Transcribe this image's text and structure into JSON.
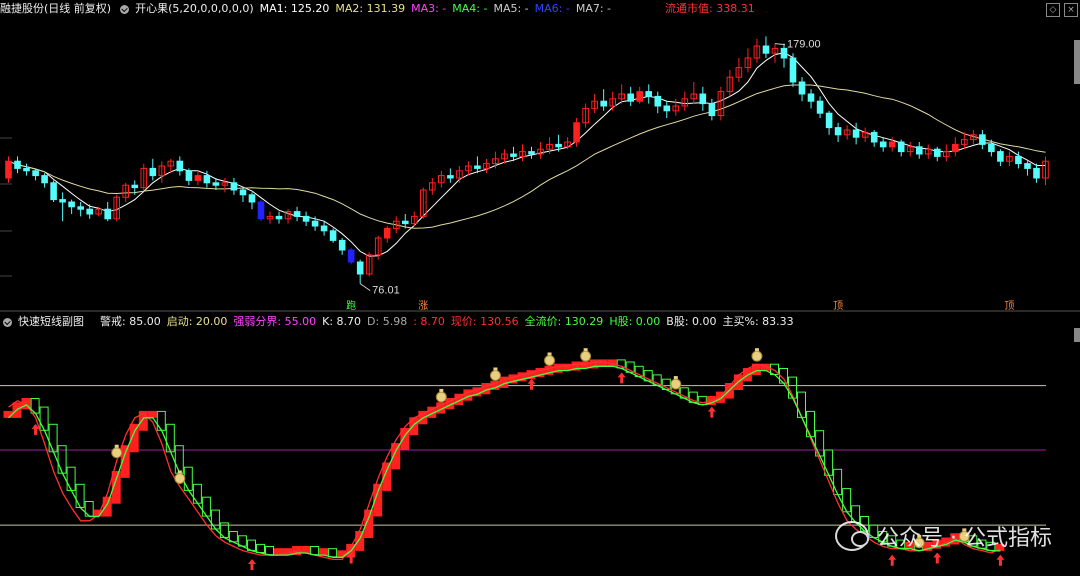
{
  "price_header": {
    "stock_name": "融捷股份(日线 前复权)",
    "indicator": "开心果(5,20,0,0,0,0,0)",
    "ma1": "MA1: 125.20",
    "ma2": "MA2: 131.39",
    "ma3": "MA3: -",
    "ma4": "MA4: -",
    "ma5": "MA5: -",
    "ma6": "MA6: -",
    "ma7": "MA7: -",
    "mktcap": "流通市值: 338.31"
  },
  "indicator_header": {
    "name": "快速短线副图",
    "alert": "警戒: 85.00",
    "start": "启动: 20.00",
    "boundary": "强弱分界: 55.00",
    "k": "K: 8.70",
    "d": "D: 5.98",
    "j": ": 8.70",
    "cost": "现价: 130.56",
    "flow": "全流价: 130.29",
    "h": "H股: 0.00",
    "b": "B股: 0.00",
    "buy": "主买%: 83.33"
  },
  "watermark": "公众号 · 公式指标",
  "colors": {
    "up": "#ff2020",
    "down": "#54fcfc",
    "blue": "#2222ff",
    "ma_short": "#ffffff",
    "ma_long": "#e0d9a0",
    "k_line": "#ff3030",
    "d_line": "#44ff44",
    "ref_line": "#c8c8a0",
    "mid_line": "#a020a0"
  },
  "chart_data": [
    {
      "type": "candlestick",
      "title": "",
      "annotations": [
        {
          "text": "179.00",
          "index": 85
        },
        {
          "text": "76.01",
          "index": 39
        },
        {
          "text": "跑",
          "index": 38
        },
        {
          "text": "涨",
          "index": 46
        },
        {
          "text": "顶",
          "index": 92
        },
        {
          "text": "顶",
          "index": 111
        }
      ],
      "ylim": [
        70,
        185
      ],
      "candles": [
        [
          120,
          127,
          129,
          118
        ],
        [
          127,
          124,
          129,
          122
        ],
        [
          124,
          123,
          126,
          121
        ],
        [
          123,
          121,
          124,
          119
        ],
        [
          121,
          118,
          122,
          116
        ],
        [
          118,
          111,
          119,
          110
        ],
        [
          111,
          110,
          114,
          102
        ],
        [
          110,
          108,
          111,
          105
        ],
        [
          108,
          107,
          110,
          104
        ],
        [
          107,
          105,
          109,
          103
        ],
        [
          105,
          107,
          108,
          104
        ],
        [
          107,
          103,
          110,
          102
        ],
        [
          103,
          112,
          113,
          102
        ],
        [
          112,
          117,
          118,
          110
        ],
        [
          117,
          116,
          119,
          113
        ],
        [
          116,
          124,
          126,
          115
        ],
        [
          124,
          121,
          128,
          119
        ],
        [
          121,
          125,
          127,
          118
        ],
        [
          125,
          127,
          128,
          122
        ],
        [
          127,
          123,
          129,
          121
        ],
        [
          123,
          119,
          124,
          117
        ],
        [
          119,
          121,
          123,
          117
        ],
        [
          121,
          118,
          123,
          116
        ],
        [
          118,
          117,
          120,
          115
        ],
        [
          117,
          118,
          120,
          114
        ],
        [
          118,
          115,
          120,
          113
        ],
        [
          115,
          113,
          116,
          110
        ],
        [
          113,
          110,
          114,
          107
        ],
        [
          110,
          103,
          111,
          102
        ],
        [
          103,
          104,
          106,
          101
        ],
        [
          104,
          103,
          106,
          101
        ],
        [
          103,
          106,
          107,
          101
        ],
        [
          106,
          104,
          108,
          102
        ],
        [
          104,
          102,
          106,
          100
        ],
        [
          102,
          100,
          104,
          98
        ],
        [
          100,
          98,
          102,
          96
        ],
        [
          98,
          94,
          99,
          93
        ],
        [
          94,
          90,
          95,
          88
        ],
        [
          90,
          85,
          91,
          84
        ],
        [
          85,
          80,
          86,
          76
        ],
        [
          80,
          88,
          89,
          79
        ],
        [
          88,
          95,
          96,
          86
        ],
        [
          95,
          99,
          100,
          93
        ],
        [
          99,
          102,
          104,
          97
        ],
        [
          102,
          101,
          105,
          99
        ],
        [
          101,
          104,
          106,
          100
        ],
        [
          104,
          115,
          116,
          103
        ],
        [
          115,
          118,
          120,
          113
        ],
        [
          118,
          121,
          123,
          116
        ],
        [
          121,
          120,
          124,
          118
        ],
        [
          120,
          123,
          125,
          118
        ],
        [
          123,
          125,
          127,
          121
        ],
        [
          125,
          124,
          129,
          122
        ],
        [
          124,
          126,
          128,
          122
        ],
        [
          126,
          128,
          131,
          124
        ],
        [
          128,
          130,
          132,
          126
        ],
        [
          130,
          129,
          133,
          127
        ],
        [
          129,
          131,
          134,
          127
        ],
        [
          131,
          130,
          133,
          128
        ],
        [
          130,
          132,
          135,
          128
        ],
        [
          132,
          134,
          137,
          130
        ],
        [
          134,
          133,
          138,
          131
        ],
        [
          133,
          135,
          137,
          132
        ],
        [
          135,
          143,
          145,
          133
        ],
        [
          143,
          149,
          151,
          141
        ],
        [
          149,
          152,
          155,
          147
        ],
        [
          152,
          150,
          157,
          148
        ],
        [
          150,
          153,
          156,
          148
        ],
        [
          153,
          155,
          159,
          151
        ],
        [
          155,
          152,
          158,
          150
        ],
        [
          152,
          156,
          158,
          151
        ],
        [
          156,
          154,
          159,
          151
        ],
        [
          154,
          150,
          156,
          147
        ],
        [
          150,
          148,
          152,
          145
        ],
        [
          148,
          150,
          153,
          146
        ],
        [
          150,
          153,
          156,
          148
        ],
        [
          153,
          155,
          160,
          151
        ],
        [
          155,
          151,
          158,
          148
        ],
        [
          151,
          146,
          153,
          144
        ],
        [
          146,
          156,
          158,
          144
        ],
        [
          156,
          162,
          165,
          154
        ],
        [
          162,
          166,
          170,
          160
        ],
        [
          166,
          170,
          174,
          164
        ],
        [
          170,
          175,
          178,
          168
        ],
        [
          175,
          172,
          179,
          170
        ],
        [
          172,
          174,
          176,
          168
        ],
        [
          174,
          170,
          176,
          166
        ],
        [
          170,
          160,
          172,
          158
        ],
        [
          160,
          155,
          162,
          152
        ],
        [
          155,
          152,
          157,
          149
        ],
        [
          152,
          147,
          154,
          145
        ],
        [
          147,
          141,
          148,
          138
        ],
        [
          141,
          138,
          143,
          135
        ],
        [
          138,
          140,
          142,
          136
        ],
        [
          140,
          137,
          143,
          134
        ],
        [
          137,
          139,
          141,
          135
        ],
        [
          139,
          135,
          140,
          133
        ],
        [
          135,
          133,
          137,
          131
        ],
        [
          133,
          135,
          137,
          131
        ],
        [
          135,
          131,
          136,
          129
        ],
        [
          131,
          133,
          135,
          129
        ],
        [
          133,
          130,
          135,
          128
        ],
        [
          130,
          132,
          134,
          128
        ],
        [
          132,
          129,
          133,
          127
        ],
        [
          129,
          131,
          134,
          127
        ],
        [
          131,
          134,
          137,
          129
        ],
        [
          134,
          136,
          139,
          132
        ],
        [
          136,
          138,
          140,
          134
        ],
        [
          138,
          134,
          140,
          132
        ],
        [
          134,
          131,
          136,
          129
        ],
        [
          131,
          127,
          132,
          125
        ],
        [
          127,
          129,
          131,
          125
        ],
        [
          129,
          126,
          131,
          124
        ],
        [
          126,
          124,
          127,
          121
        ],
        [
          124,
          120,
          126,
          118
        ],
        [
          120,
          127,
          129,
          117
        ]
      ]
    },
    {
      "type": "line",
      "title": "",
      "ylim": [
        0,
        110
      ],
      "reference_lines": [
        85,
        55,
        20
      ],
      "series_k": [
        75,
        78,
        76,
        70,
        58,
        45,
        35,
        28,
        22,
        22,
        25,
        35,
        50,
        62,
        70,
        72,
        68,
        58,
        45,
        38,
        32,
        26,
        20,
        15,
        12,
        10,
        8,
        7,
        6,
        6,
        6,
        7,
        8,
        7,
        6,
        5,
        4,
        4,
        10,
        18,
        30,
        42,
        52,
        60,
        66,
        70,
        72,
        74,
        76,
        78,
        80,
        82,
        83,
        85,
        86,
        88,
        89,
        90,
        91,
        92,
        93,
        94,
        94,
        95,
        95,
        96,
        96,
        95,
        94,
        92,
        90,
        88,
        86,
        84,
        82,
        80,
        78,
        77,
        78,
        80,
        85,
        90,
        93,
        95,
        94,
        92,
        88,
        80,
        70,
        60,
        50,
        40,
        30,
        22,
        18,
        15,
        12,
        10,
        9,
        9,
        8,
        8,
        9,
        10,
        12,
        14,
        11,
        9,
        8,
        7,
        9
      ],
      "series_d": [
        70,
        74,
        76,
        72,
        64,
        54,
        44,
        36,
        28,
        24,
        24,
        30,
        42,
        54,
        64,
        70,
        70,
        64,
        54,
        44,
        36,
        30,
        24,
        18,
        14,
        12,
        10,
        8,
        7,
        6,
        6,
        6,
        7,
        7,
        6,
        6,
        5,
        5,
        8,
        14,
        24,
        36,
        46,
        55,
        62,
        67,
        70,
        72,
        74,
        76,
        78,
        80,
        81,
        83,
        84,
        86,
        87,
        88,
        89,
        90,
        91,
        92,
        92,
        93,
        93,
        94,
        94,
        94,
        93,
        91,
        89,
        87,
        85,
        83,
        81,
        79,
        77,
        76,
        77,
        79,
        83,
        87,
        90,
        92,
        92,
        90,
        86,
        79,
        70,
        61,
        52,
        43,
        34,
        26,
        21,
        17,
        14,
        12,
        10,
        9,
        9,
        8,
        9,
        10,
        11,
        13,
        12,
        10,
        9,
        8,
        8
      ],
      "buy_signals": [
        3,
        27,
        38,
        58,
        68,
        78,
        98,
        103,
        110
      ],
      "sell_signals": [
        12,
        19,
        48,
        54,
        60,
        64,
        74,
        83,
        101,
        106
      ]
    }
  ]
}
